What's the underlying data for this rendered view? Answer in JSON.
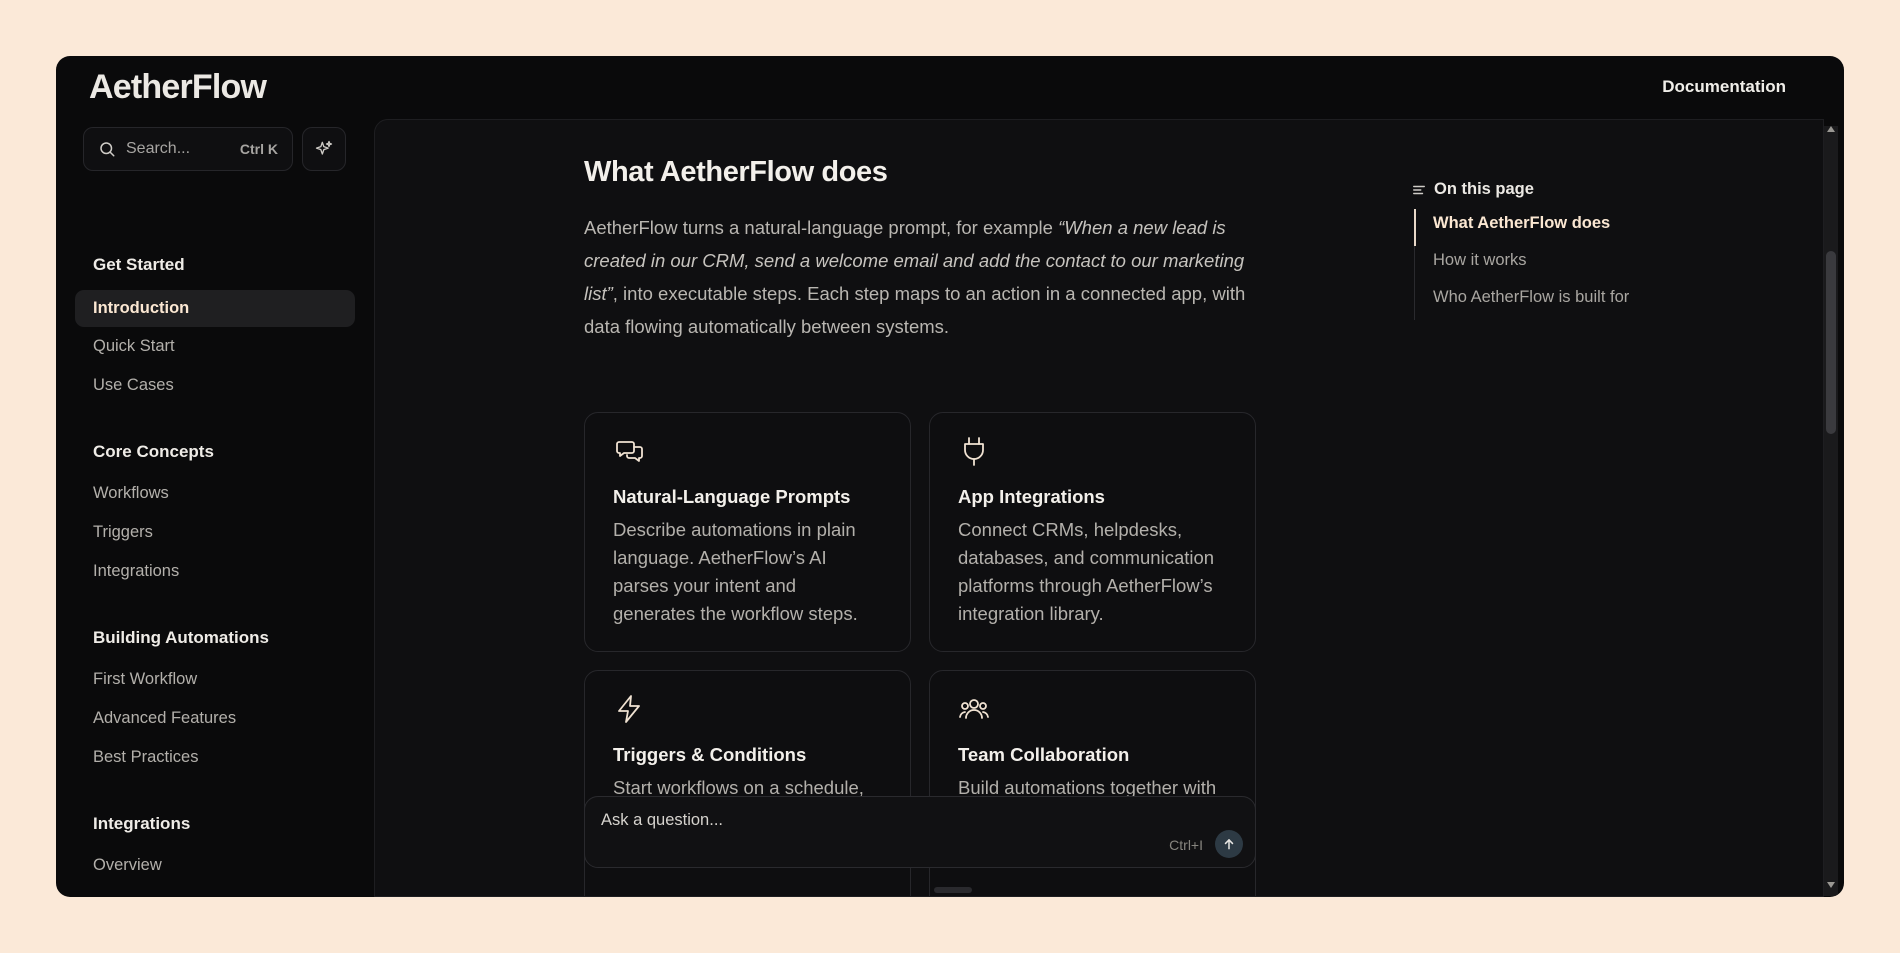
{
  "app": {
    "logo": "AetherFlow",
    "documentation_link": "Documentation"
  },
  "sidebar": {
    "search": {
      "placeholder": "Search...",
      "shortcut": "Ctrl K"
    },
    "sections": [
      {
        "title": "Get Started",
        "items": [
          "Introduction",
          "Quick Start",
          "Use Cases"
        ]
      },
      {
        "title": "Core Concepts",
        "items": [
          "Workflows",
          "Triggers",
          "Integrations"
        ]
      },
      {
        "title": "Building Automations",
        "items": [
          "First Workflow",
          "Advanced Features",
          "Best Practices"
        ]
      },
      {
        "title": "Integrations",
        "items": [
          "Overview"
        ]
      }
    ],
    "active_item": "Introduction",
    "theme_modes": [
      "monitor-icon",
      "sun-icon",
      "moon-icon"
    ],
    "active_theme": "moon-icon"
  },
  "main": {
    "title": "What AetherFlow does",
    "intro_start": "AetherFlow turns a natural-language prompt, for example ",
    "intro_quote": "“When a new lead is created in our CRM, send a welcome email and add the contact to our marketing list”",
    "intro_end": ", into executable steps. Each step maps to an action in a connected app, with data flowing automatically between systems.",
    "cards": [
      {
        "icon": "chat-bubbles-icon",
        "title": "Natural-Language Prompts",
        "desc": "Describe automations in plain language. AetherFlow’s AI parses your intent and generates the workflow steps."
      },
      {
        "icon": "plug-icon",
        "title": "App Integrations",
        "desc": "Connect CRMs, helpdesks, databases, and communication platforms through AetherFlow’s integration library."
      },
      {
        "icon": "lightning-icon",
        "title": "Triggers & Conditions",
        "desc": "Start workflows on a schedule, from an app event, or via"
      },
      {
        "icon": "users-icon",
        "title": "Team Collaboration",
        "desc": "Build automations together with role-based access control for"
      }
    ],
    "ask": {
      "placeholder": "Ask a question...",
      "shortcut": "Ctrl+I"
    }
  },
  "toc": {
    "heading": "On this page",
    "items": [
      "What AetherFlow does",
      "How it works",
      "Who AetherFlow is built for"
    ],
    "active": "What AetherFlow does"
  },
  "colors": {
    "accent": "#fbe7d2",
    "background": "#0a0a0b",
    "page": "#fbe9d8"
  }
}
